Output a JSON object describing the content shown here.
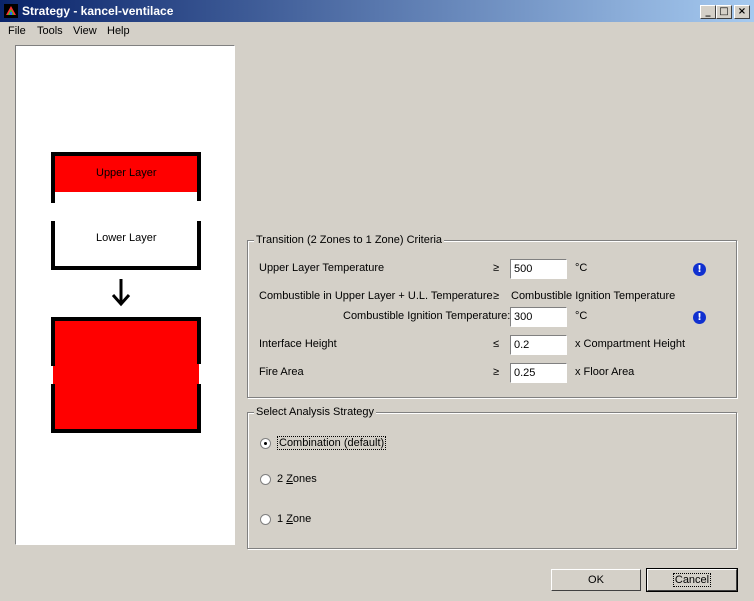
{
  "window": {
    "title": "Strategy - kancel-ventilace",
    "minimize_glyph": "_",
    "maximize_glyph": "□",
    "close_glyph": "×"
  },
  "menu": [
    {
      "label": "File"
    },
    {
      "label": "Tools"
    },
    {
      "label": "View"
    },
    {
      "label": "Help"
    }
  ],
  "preview": {
    "upper_layer_label": "Upper Layer",
    "lower_layer_label": "Lower Layer",
    "layer_color": "#ff0000"
  },
  "criteria": {
    "legend": "Transition (2 Zones to 1 Zone) Criteria",
    "rows": {
      "upper_temp": {
        "label": "Upper Layer Temperature",
        "operator": "≥",
        "value": "500",
        "unit": "°C"
      },
      "combustible": {
        "label": "Combustible in Upper Layer + U.L. Temperature",
        "operator": "≥",
        "rhs": "Combustible Ignition Temperature"
      },
      "ignition": {
        "label": "Combustible Ignition Temperature:",
        "value": "300",
        "unit": "°C"
      },
      "interface": {
        "label": "Interface Height",
        "operator": "≤",
        "value": "0.2",
        "unit": "x Compartment Height"
      },
      "fire_area": {
        "label": "Fire Area",
        "operator": "≥",
        "value": "0.25",
        "unit": "x Floor Area"
      }
    },
    "info_glyph": "!"
  },
  "strategy": {
    "legend": "Select Analysis Strategy",
    "options": [
      {
        "label": "Combination (default)",
        "selected": true
      },
      {
        "label_pre": "2 ",
        "label_key": "Z",
        "label_post": "ones",
        "selected": false
      },
      {
        "label_pre": "1 ",
        "label_key": "Z",
        "label_post": "one",
        "selected": false
      }
    ]
  },
  "buttons": {
    "ok": "OK",
    "cancel": "Cancel"
  }
}
